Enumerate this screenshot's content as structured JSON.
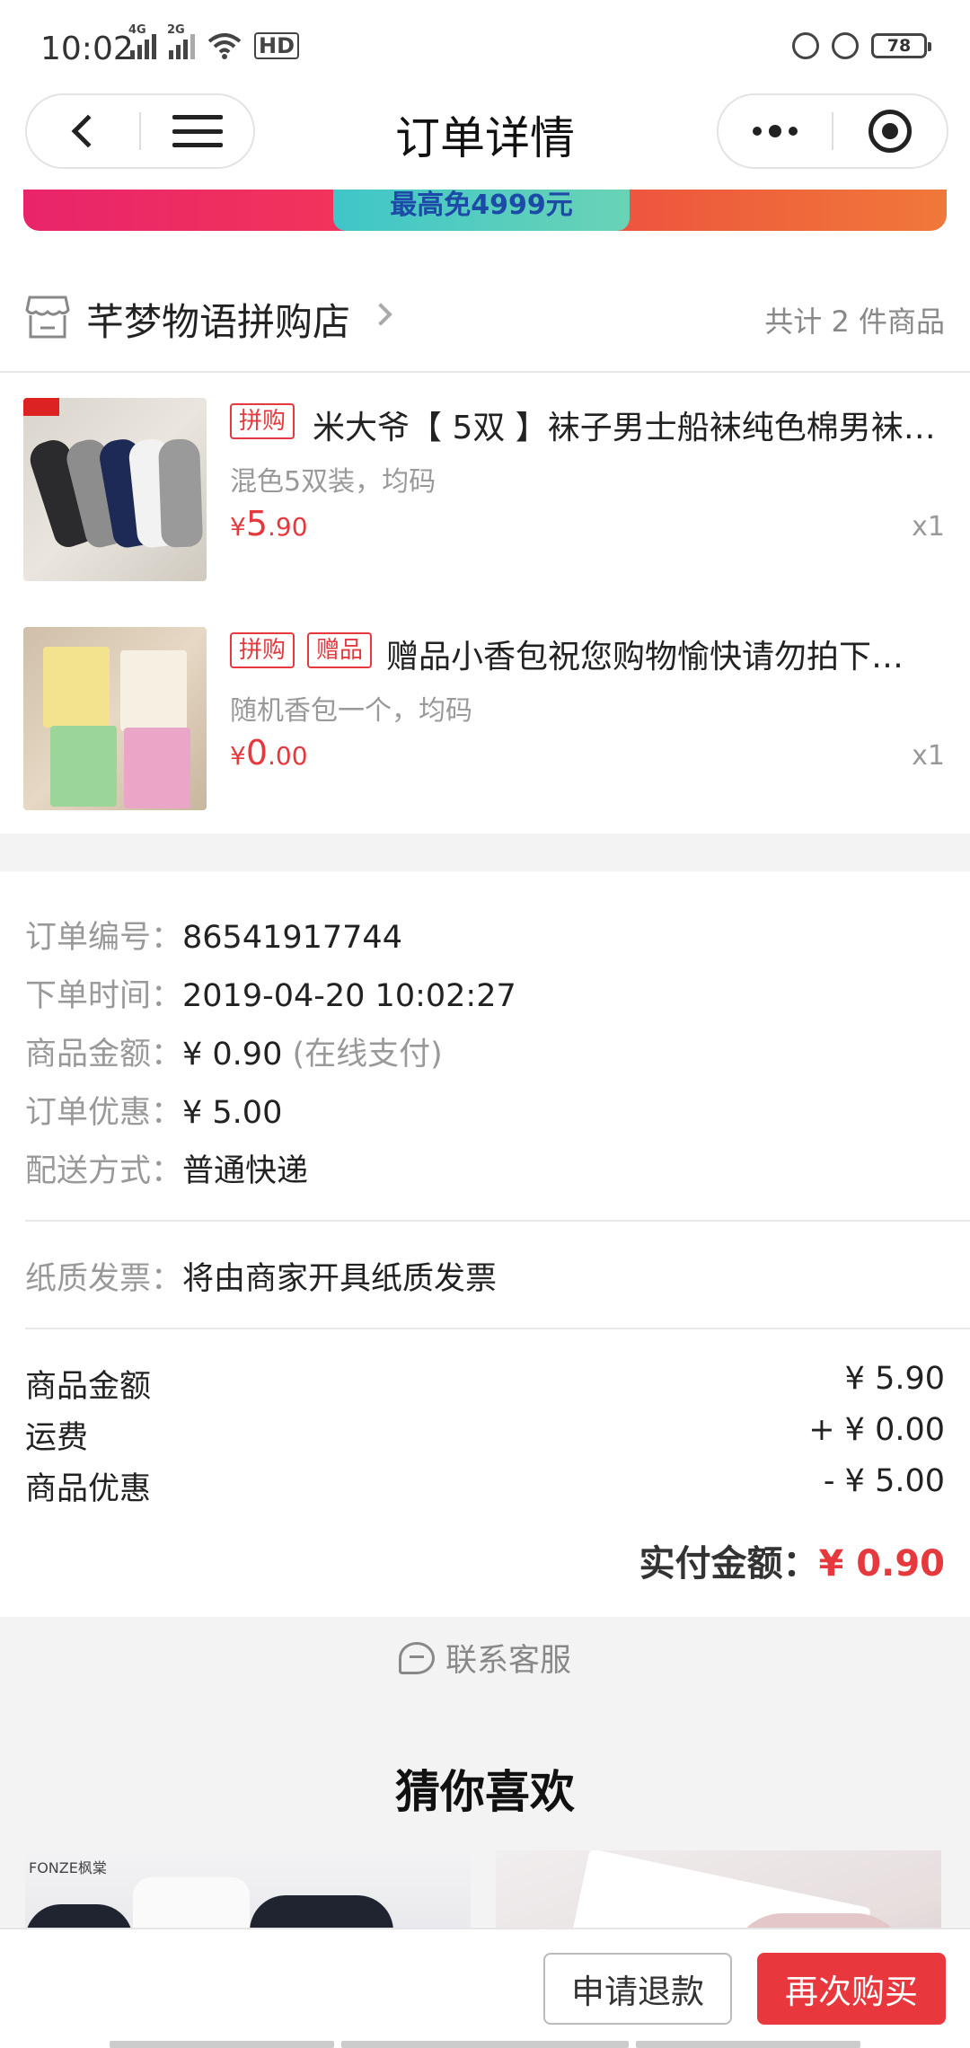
{
  "status_bar": {
    "time": "10:02",
    "net1": "4G",
    "net2": "2G",
    "hd": "HD",
    "battery": "78"
  },
  "titlebar": {
    "title": "订单详情"
  },
  "banner": {
    "text": "最高免4999元"
  },
  "store": {
    "name": "芊梦物语拼购店",
    "count": "共计 2 件商品"
  },
  "products": [
    {
      "tags": [
        "拼购"
      ],
      "title": "米大爷【 5双 】袜子男士船袜纯色棉男袜…",
      "spec": "混色5双装，均码",
      "price_cur": "¥",
      "price_int": "5",
      "price_dec": ".90",
      "qty": "x1"
    },
    {
      "tags": [
        "拼购",
        "赠品"
      ],
      "title": "赠品小香包祝您购物愉快请勿拍下…",
      "spec": "随机香包一个，均码",
      "price_cur": "¥",
      "price_int": "0",
      "price_dec": ".00",
      "qty": "x1"
    }
  ],
  "order_info": {
    "order_no_label": "订单编号：",
    "order_no": "86541917744",
    "time_label": "下单时间：",
    "time": "2019-04-20 10:02:27",
    "amount_label": "商品金额：",
    "amount": "¥ 0.90",
    "amount_note": "(在线支付)",
    "discount_label": "订单优惠：",
    "discount": "¥ 5.00",
    "ship_label": "配送方式：",
    "ship": "普通快递",
    "invoice_label": "纸质发票：",
    "invoice": "将由商家开具纸质发票"
  },
  "summary": {
    "goods_label": "商品金额",
    "goods_value": "¥ 5.90",
    "freight_label": "运费",
    "freight_value": "+ ¥ 0.00",
    "promo_label": "商品优惠",
    "promo_value": "- ¥ 5.00",
    "paid_label": "实付金额：",
    "paid_value": "¥ 0.90"
  },
  "service": {
    "label": "联系客服"
  },
  "recommend": {
    "title": "猜你喜欢",
    "brand1": "FONZE枫棠"
  },
  "actions": {
    "refund": "申请退款",
    "rebuy": "再次购买"
  },
  "colors": {
    "accent": "#e5393e",
    "button_red": "#e8383d"
  }
}
